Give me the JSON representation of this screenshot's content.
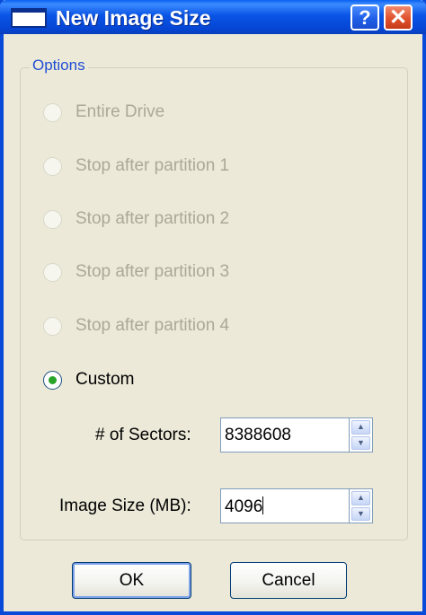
{
  "window": {
    "title": "New Image Size",
    "help_glyph": "?",
    "close_glyph": "✕"
  },
  "options": {
    "legend": "Options",
    "radios": [
      {
        "label": "Entire Drive",
        "enabled": false,
        "selected": false
      },
      {
        "label": "Stop after partition 1",
        "enabled": false,
        "selected": false
      },
      {
        "label": "Stop after partition 2",
        "enabled": false,
        "selected": false
      },
      {
        "label": "Stop after partition 3",
        "enabled": false,
        "selected": false
      },
      {
        "label": "Stop after partition 4",
        "enabled": false,
        "selected": false
      },
      {
        "label": "Custom",
        "enabled": true,
        "selected": true
      }
    ],
    "sectors": {
      "label": "# of Sectors:",
      "value": "8388608"
    },
    "image_size": {
      "label": "Image Size (MB):",
      "value": "4096"
    }
  },
  "buttons": {
    "ok": "OK",
    "cancel": "Cancel"
  },
  "icons": {
    "spin_up": "▲",
    "spin_down": "▼"
  }
}
